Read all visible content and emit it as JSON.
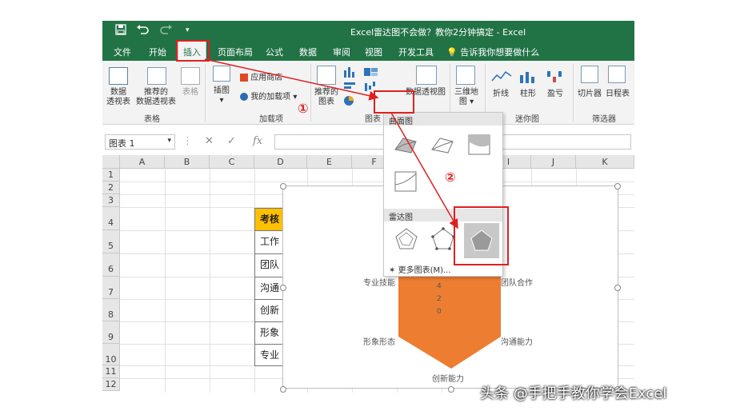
{
  "window": {
    "title": "Excel雷达图不会做？教你2分钟搞定 - Excel"
  },
  "tabs": [
    "文件",
    "开始",
    "插入",
    "页面布局",
    "公式",
    "数据",
    "审阅",
    "视图",
    "开发工具"
  ],
  "active_tab": "插入",
  "tell_me": "告诉我你想要做什么",
  "ribbon": {
    "pivot_table": [
      "数据",
      "透视表"
    ],
    "recommended_pivot": [
      "推荐的",
      "数据透视表"
    ],
    "table": "表格",
    "illustrations": "插图",
    "app_store": "应用商店",
    "my_addins": "我的加载项",
    "recommended_charts": [
      "推荐的",
      "图表"
    ],
    "pivot_chart": "数据透视图",
    "map_3d": [
      "三维地",
      "图"
    ],
    "sparkline_line": "折线",
    "sparkline_column": "柱形",
    "sparkline_winloss": "盈亏",
    "slicer": "切片器",
    "timeline": "日程表",
    "groups": {
      "tables": "表格",
      "addins": "加载项",
      "charts": "图表",
      "sparklines": "迷你图",
      "filters": "筛选器"
    }
  },
  "name_box": "图表 1",
  "fx_label": "fx",
  "columns": [
    "A",
    "B",
    "C",
    "D",
    "E",
    "F",
    "G",
    "H",
    "I",
    "J",
    "K"
  ],
  "rows": [
    "1",
    "2",
    "3",
    "4",
    "5",
    "6",
    "7",
    "8",
    "9",
    "10",
    "11",
    "12"
  ],
  "cells": {
    "header": "考核",
    "items": [
      "工作",
      "团队",
      "沟通",
      "创新",
      "形象",
      "专业"
    ]
  },
  "chart": {
    "axis_labels": {
      "top_left": "专业技能",
      "top_right": "团队合作",
      "bottom_left": "形象形态",
      "bottom_right": "沟通能力",
      "bottom": "创新能力"
    },
    "ticks": [
      "4",
      "2",
      "0"
    ],
    "fill_color": "#ED7D31"
  },
  "dropdown": {
    "surface_header": "曲面图",
    "radar_header": "雷达图",
    "more_charts": "更多图表(M)..."
  },
  "annotations": {
    "step1": "①",
    "step2": "②",
    "arrow_color": "#E02020"
  },
  "watermark": "头条 @手把手教你学会Excel"
}
